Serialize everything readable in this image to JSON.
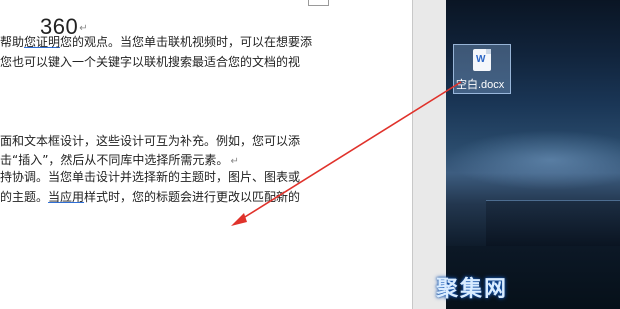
{
  "document": {
    "title": "360",
    "para_mark": "↵",
    "lines": [
      {
        "segments": [
          {
            "text": "帮助"
          },
          {
            "text": "您证明",
            "underline": true
          },
          {
            "text": "您的观点。当您单击联机视频时，可以在想要添"
          }
        ]
      },
      {
        "segments": [
          {
            "text": "您也可以键入一个关键字以联机搜索最适合您的文档的视"
          }
        ]
      },
      {
        "segments": [
          {
            "text": "面和文本框设计，这些设计可互为补充。例如，您可以添"
          }
        ]
      },
      {
        "segments": [
          {
            "text": "击“插入”，然后从不同库中选择所需元素。"
          },
          {
            "text": "↵",
            "mark": true
          }
        ]
      },
      {
        "segments": [
          {
            "text": "持协调。当您单击设计并选择新的主题时，图片、图表或"
          }
        ]
      },
      {
        "segments": [
          {
            "text": "的主题。"
          },
          {
            "text": "当应用",
            "underline": true
          },
          {
            "text": "样式时，您的标题会进行更改以匹配新的"
          }
        ]
      }
    ]
  },
  "desktop": {
    "file_label": "空白.docx",
    "file_icon": "word-document-icon",
    "watermark": "聚集网"
  },
  "annotation": {
    "arrow_color": "#e0322b"
  }
}
